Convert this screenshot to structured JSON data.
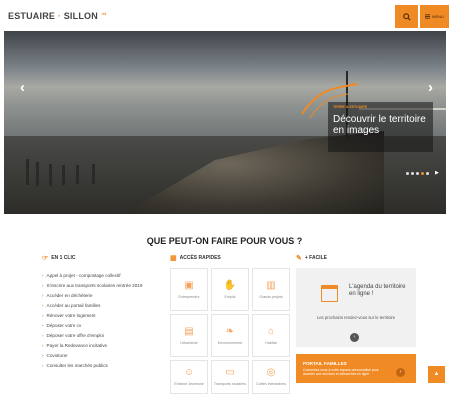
{
  "header": {
    "logo_text": "ESTUAIRE",
    "logo_text2": "SILLON",
    "logo_sup": "44",
    "search_icon": "magnifier-icon",
    "menu_label": "MENU"
  },
  "hero": {
    "kicker": "TERRE & ESTUAIRE",
    "title": "Découvrir le territoire en images",
    "prev_symbol": "‹",
    "next_symbol": "›",
    "slide_count": 5,
    "active_slide": 4
  },
  "main": {
    "section_title": "QUE PEUT-ON FAIRE POUR VOUS ?"
  },
  "one_click": {
    "heading": "EN 1 CLIC",
    "links": [
      "Appel à projet - compostage collectif",
      "S'inscrire aux transports scolaires rentrée 2019",
      "Accéder en déchèterie",
      "Accéder au portail familles",
      "Rénover votre logement",
      "Déposer votre cv",
      "Déposer votre offre d'emploi",
      "Payer la Redevance incitative",
      "Covoiturer",
      "Consulter les marchés publics"
    ]
  },
  "quick_access": {
    "heading": "ACCÈS RAPIDES",
    "tiles": [
      {
        "label": "Entreprendre",
        "icon": "briefcase-icon"
      },
      {
        "label": "Emploi",
        "icon": "handshake-icon"
      },
      {
        "label": "Grands projets",
        "icon": "building-icon"
      },
      {
        "label": "Urbanisme",
        "icon": "city-icon"
      },
      {
        "label": "Environnement",
        "icon": "leaf-icon"
      },
      {
        "label": "Habitat",
        "icon": "house-icon"
      },
      {
        "label": "Enfance Jeunesse",
        "icon": "child-icon"
      },
      {
        "label": "Transports scolaires",
        "icon": "bus-icon"
      },
      {
        "label": "Cartes interactives",
        "icon": "map-icon"
      }
    ]
  },
  "facile": {
    "heading": "+ FACILE",
    "agenda_title": "L'agenda du territoire en ligne !",
    "agenda_sub": "Les prochains rendez-vous sur le territoire",
    "go_symbol": "›",
    "portail_title": "PORTAIL FAMILLES",
    "portail_text": "Connectez-vous à votre espace personnalisé pour accéder aux services et démarches en ligne",
    "top_symbol": "▲"
  },
  "colors": {
    "accent": "#f08a24",
    "text": "#333333"
  }
}
